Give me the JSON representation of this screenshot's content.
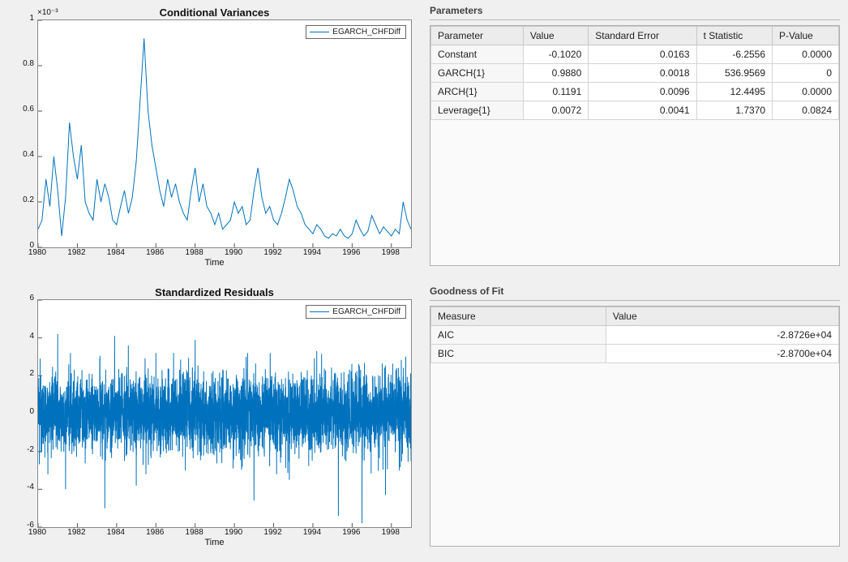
{
  "chart_data": [
    {
      "type": "line",
      "title": "Conditional Variances",
      "xlabel": "Time",
      "ylabel": "",
      "y_exponent_label": "×10⁻³",
      "ylim": [
        0,
        1
      ],
      "xlim": [
        1980,
        1999
      ],
      "xticks": [
        1980,
        1982,
        1984,
        1986,
        1988,
        1990,
        1992,
        1994,
        1996,
        1998
      ],
      "yticks": [
        0,
        0.2,
        0.4,
        0.6,
        0.8,
        1
      ],
      "legend": [
        "EGARCH_CHFDiff"
      ],
      "note": "values are ×1e-3",
      "series": [
        {
          "name": "EGARCH_CHFDiff",
          "x": [
            1980.0,
            1980.2,
            1980.4,
            1980.6,
            1980.8,
            1981.0,
            1981.2,
            1981.4,
            1981.6,
            1981.8,
            1982.0,
            1982.2,
            1982.4,
            1982.6,
            1982.8,
            1983.0,
            1983.2,
            1983.4,
            1983.6,
            1983.8,
            1984.0,
            1984.2,
            1984.4,
            1984.6,
            1984.8,
            1985.0,
            1985.2,
            1985.4,
            1985.6,
            1985.8,
            1986.0,
            1986.2,
            1986.4,
            1986.6,
            1986.8,
            1987.0,
            1987.2,
            1987.4,
            1987.6,
            1987.8,
            1988.0,
            1988.2,
            1988.4,
            1988.6,
            1988.8,
            1989.0,
            1989.2,
            1989.4,
            1989.6,
            1989.8,
            1990.0,
            1990.2,
            1990.4,
            1990.6,
            1990.8,
            1991.0,
            1991.2,
            1991.4,
            1991.6,
            1991.8,
            1992.0,
            1992.2,
            1992.4,
            1992.6,
            1992.8,
            1993.0,
            1993.2,
            1993.4,
            1993.6,
            1993.8,
            1994.0,
            1994.2,
            1994.4,
            1994.6,
            1994.8,
            1995.0,
            1995.2,
            1995.4,
            1995.6,
            1995.8,
            1996.0,
            1996.2,
            1996.4,
            1996.6,
            1996.8,
            1997.0,
            1997.2,
            1997.4,
            1997.6,
            1997.8,
            1998.0,
            1998.2,
            1998.4,
            1998.6,
            1998.8,
            1999.0
          ],
          "values": [
            0.08,
            0.12,
            0.3,
            0.18,
            0.4,
            0.25,
            0.05,
            0.22,
            0.55,
            0.4,
            0.3,
            0.45,
            0.2,
            0.15,
            0.12,
            0.3,
            0.2,
            0.28,
            0.22,
            0.12,
            0.1,
            0.18,
            0.25,
            0.15,
            0.22,
            0.38,
            0.65,
            0.92,
            0.6,
            0.45,
            0.35,
            0.25,
            0.18,
            0.3,
            0.22,
            0.28,
            0.2,
            0.15,
            0.12,
            0.25,
            0.35,
            0.2,
            0.28,
            0.18,
            0.15,
            0.1,
            0.15,
            0.08,
            0.1,
            0.12,
            0.2,
            0.15,
            0.18,
            0.1,
            0.12,
            0.25,
            0.35,
            0.22,
            0.15,
            0.18,
            0.12,
            0.1,
            0.15,
            0.22,
            0.3,
            0.25,
            0.18,
            0.15,
            0.1,
            0.08,
            0.06,
            0.1,
            0.08,
            0.05,
            0.04,
            0.06,
            0.05,
            0.08,
            0.05,
            0.04,
            0.06,
            0.12,
            0.08,
            0.05,
            0.07,
            0.14,
            0.1,
            0.06,
            0.09,
            0.07,
            0.05,
            0.08,
            0.06,
            0.2,
            0.12,
            0.08
          ]
        }
      ]
    },
    {
      "type": "line",
      "title": "Standardized Residuals",
      "xlabel": "Time",
      "ylabel": "",
      "ylim": [
        -6,
        6
      ],
      "xlim": [
        1980,
        1999
      ],
      "xticks": [
        1980,
        1982,
        1984,
        1986,
        1988,
        1990,
        1992,
        1994,
        1996,
        1998
      ],
      "yticks": [
        -6,
        -4,
        -2,
        0,
        2,
        4,
        6
      ],
      "legend": [
        "EGARCH_CHFDiff"
      ],
      "zero_line": true,
      "note": "dense noise roughly in [-3,3] with occasional spikes to ~±5.5",
      "series": [
        {
          "name": "EGARCH_CHFDiff",
          "type": "noise",
          "count": 4500,
          "mean": 0.0,
          "stdev": 1.0,
          "extreme_spikes": [
            {
              "x": 1980.1,
              "y": 2.9
            },
            {
              "x": 1980.5,
              "y": -3.2
            },
            {
              "x": 1981.0,
              "y": 4.2
            },
            {
              "x": 1981.4,
              "y": -4.0
            },
            {
              "x": 1983.4,
              "y": -5.0
            },
            {
              "x": 1983.9,
              "y": 4.1
            },
            {
              "x": 1984.6,
              "y": 3.6
            },
            {
              "x": 1985.0,
              "y": -3.8
            },
            {
              "x": 1986.0,
              "y": 3.2
            },
            {
              "x": 1987.5,
              "y": -3.0
            },
            {
              "x": 1988.0,
              "y": 3.9
            },
            {
              "x": 1990.6,
              "y": 3.0
            },
            {
              "x": 1991.0,
              "y": -4.6
            },
            {
              "x": 1992.8,
              "y": -3.5
            },
            {
              "x": 1994.2,
              "y": 3.3
            },
            {
              "x": 1995.3,
              "y": -5.4
            },
            {
              "x": 1996.5,
              "y": -5.8
            },
            {
              "x": 1997.7,
              "y": -4.3
            },
            {
              "x": 1998.4,
              "y": -3.0
            }
          ]
        }
      ]
    }
  ],
  "params_panel": {
    "title": "Parameters",
    "columns": [
      "Parameter",
      "Value",
      "Standard Error",
      "t Statistic",
      "P-Value"
    ],
    "rows": [
      {
        "Parameter": "Constant",
        "Value": "-0.1020",
        "Standard Error": "0.0163",
        "t Statistic": "-6.2556",
        "P-Value": "0.0000"
      },
      {
        "Parameter": "GARCH{1}",
        "Value": "0.9880",
        "Standard Error": "0.0018",
        "t Statistic": "536.9569",
        "P-Value": "0"
      },
      {
        "Parameter": "ARCH{1}",
        "Value": "0.1191",
        "Standard Error": "0.0096",
        "t Statistic": "12.4495",
        "P-Value": "0.0000"
      },
      {
        "Parameter": "Leverage{1}",
        "Value": "0.0072",
        "Standard Error": "0.0041",
        "t Statistic": "1.7370",
        "P-Value": "0.0824"
      }
    ]
  },
  "gof_panel": {
    "title": "Goodness of Fit",
    "columns": [
      "Measure",
      "Value"
    ],
    "rows": [
      {
        "Measure": "AIC",
        "Value": "-2.8726e+04"
      },
      {
        "Measure": "BIC",
        "Value": "-2.8700e+04"
      }
    ]
  }
}
